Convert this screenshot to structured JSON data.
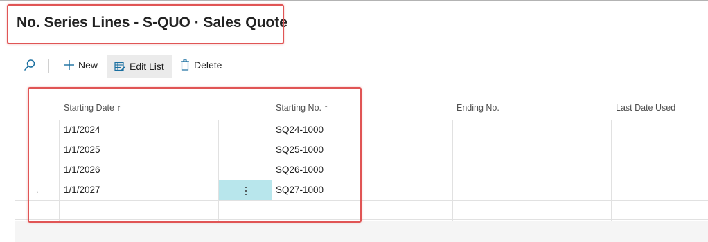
{
  "page": {
    "title": "No. Series Lines - S-QUO · Sales Quote"
  },
  "toolbar": {
    "new_label": "New",
    "edit_list_label": "Edit List",
    "delete_label": "Delete"
  },
  "grid": {
    "columns": [
      {
        "label": "Starting Date",
        "sort": "↑"
      },
      {
        "label": "Starting No.",
        "sort": "↑"
      },
      {
        "label": "Ending No.",
        "sort": ""
      },
      {
        "label": "Last Date Used",
        "sort": ""
      }
    ],
    "rows": [
      {
        "starting_date": "1/1/2024",
        "starting_no": "SQ24-1000",
        "ending_no": "",
        "last_date_used": ""
      },
      {
        "starting_date": "1/1/2025",
        "starting_no": "SQ25-1000",
        "ending_no": "",
        "last_date_used": ""
      },
      {
        "starting_date": "1/1/2026",
        "starting_no": "SQ26-1000",
        "ending_no": "",
        "last_date_used": ""
      },
      {
        "starting_date": "1/1/2027",
        "starting_no": "SQ27-1000",
        "ending_no": "",
        "last_date_used": "",
        "current_row_marker": "→"
      },
      {
        "starting_date": "",
        "starting_no": "",
        "ending_no": "",
        "last_date_used": ""
      }
    ]
  },
  "colors": {
    "highlight_box": "#e05555",
    "selected_cell": "#b8e6ec",
    "edit_list_active_bg": "#ebebeb"
  }
}
